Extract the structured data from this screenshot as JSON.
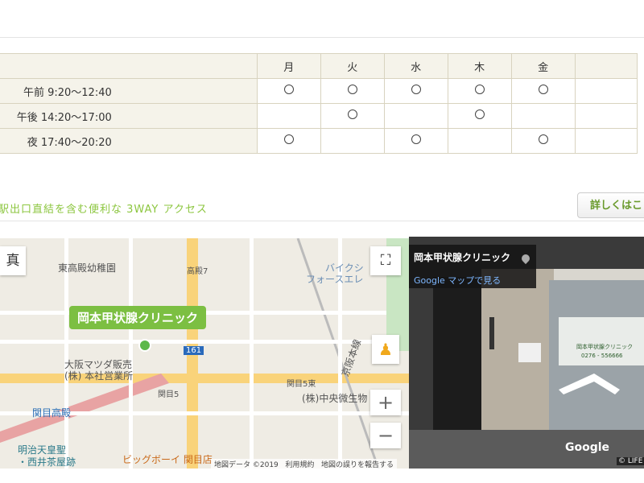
{
  "schedule": {
    "days": [
      "月",
      "火",
      "水",
      "木",
      "金"
    ],
    "rows": [
      {
        "label": "午前 9:20〜12:40",
        "marks": [
          true,
          true,
          true,
          true,
          true
        ],
        "mark_symbol": "○"
      },
      {
        "label": "午後 14:20〜17:00",
        "marks": [
          false,
          true,
          false,
          true,
          false
        ],
        "mark_symbol": "○"
      },
      {
        "label": "夜 17:40〜20:20",
        "marks": [
          true,
          false,
          true,
          false,
          true
        ],
        "mark_symbol": "○"
      }
    ]
  },
  "access": {
    "text": "駅出口直結を含む便利な 3WAY アクセス",
    "detail_button": "詳しくはこ"
  },
  "map": {
    "photo_toggle": "真",
    "pin_label": "岡本甲状腺クリニック",
    "places": [
      "東高殿幼稚園",
      "バイクシ",
      "フォースエレ",
      "大阪マツダ販売",
      "(株) 本社営業所",
      "関目5",
      "関目5東",
      "(株)中央微生物",
      "関目高殿",
      "明治天皇聖",
      "・西井茶屋跡",
      "ビッグボーイ 関目店",
      "京阪本線",
      "高殿7",
      "161"
    ],
    "footer": [
      "地図データ ©2019",
      "利用規約",
      "地図の誤りを報告する"
    ],
    "zoom_in": "+",
    "zoom_out": "−"
  },
  "streetview": {
    "title": "岡本甲状腺クリニック",
    "link": "Google マップで見る",
    "watermark": "Google",
    "copyright": "© LIFE",
    "door_text": "岡本甲状腺クリニック",
    "door_phone": "0276 - 556666"
  }
}
